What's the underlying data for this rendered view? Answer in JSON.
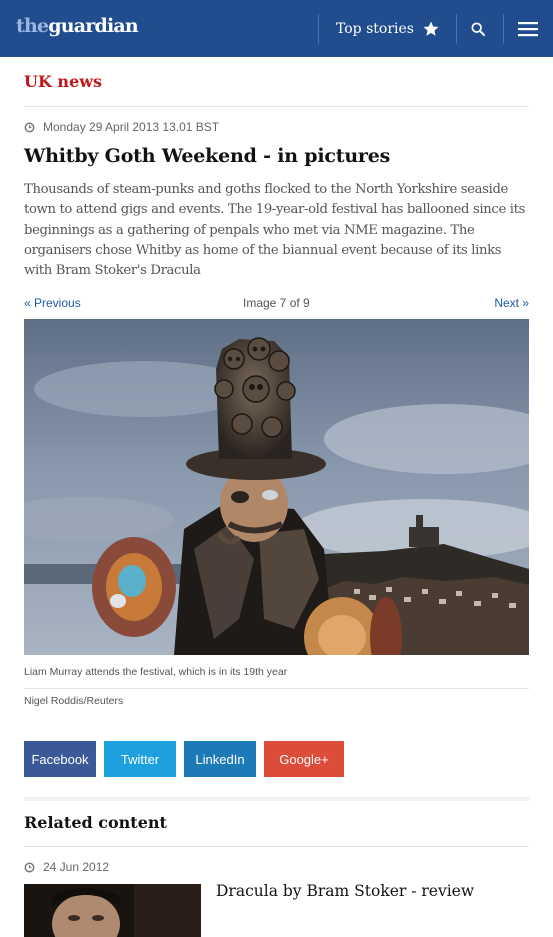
{
  "header": {
    "logo_the": "the",
    "logo_guardian": "guardian",
    "top_stories_label": "Top stories",
    "background": "#214d8f"
  },
  "section": {
    "label": "UK news",
    "color": "#c2161b"
  },
  "article": {
    "date": "Monday 29 April 2013 13.01 BST",
    "headline": "Whitby Goth Weekend - in pictures",
    "standfirst": "Thousands of steam-punks and goths flocked to the North Yorkshire seaside town to attend gigs and events. The 19-year-old festival has ballooned since its beginnings as a gathering of penpals who met via NME magazine. The organisers chose Whitby as home of the biannual event because of its links with Bram Stoker's Dracula"
  },
  "gallery": {
    "prev_label": "« Previous",
    "counter": "Image 7 of 9",
    "next_label": "Next »",
    "caption": "Liam Murray attends the festival, which is in its 19th year",
    "credit": "Nigel Roddis/Reuters"
  },
  "share": {
    "facebook": "Facebook",
    "twitter": "Twitter",
    "linkedin": "LinkedIn",
    "googleplus": "Google+",
    "colors": {
      "facebook": "#3b5998",
      "twitter": "#1da1de",
      "linkedin": "#1c7bb6",
      "googleplus": "#dd4b39"
    }
  },
  "related": {
    "title": "Related content",
    "items": [
      {
        "date": "24 Jun 2012",
        "headline": "Dracula by Bram Stoker - review"
      }
    ]
  },
  "icons": {
    "star": "star-icon",
    "search": "search-icon",
    "menu": "menu-icon",
    "clock": "clock-icon"
  }
}
